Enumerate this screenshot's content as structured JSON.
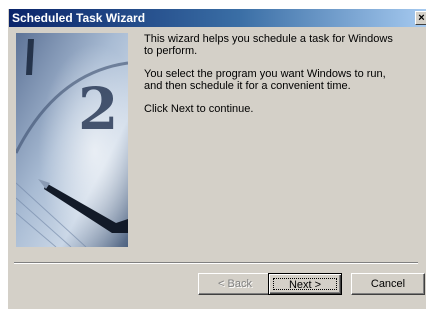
{
  "window": {
    "title": "Scheduled Task Wizard",
    "close_glyph": "×"
  },
  "body": {
    "paragraph1": "This wizard helps you schedule a task for Windows to perform.",
    "paragraph2": "You select the program you want Windows to run, and then schedule it for a convenient time.",
    "paragraph3": "Click Next to continue."
  },
  "buttons": {
    "back_label": "< Back",
    "next_label": "Next >",
    "cancel_label": "Cancel"
  },
  "colors": {
    "title_bar_start": "#0a246a",
    "title_bar_end": "#a6caf0",
    "dialog_face": "#d4d0c8"
  }
}
